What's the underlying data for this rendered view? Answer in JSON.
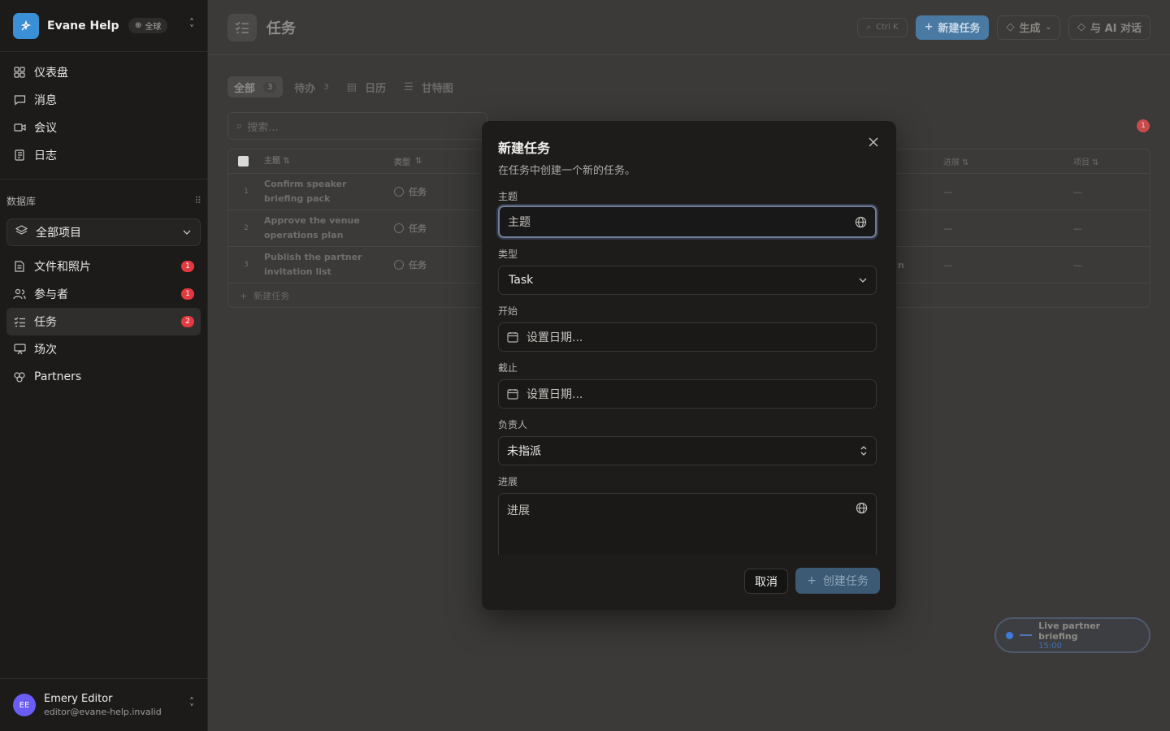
{
  "workspace": {
    "name": "Evane Help ...",
    "badge": "全球"
  },
  "nav": [
    {
      "label": "仪表盘",
      "icon": "dashboard-icon"
    },
    {
      "label": "消息",
      "icon": "message-icon"
    },
    {
      "label": "会议",
      "icon": "video-icon"
    },
    {
      "label": "日志",
      "icon": "journal-icon"
    }
  ],
  "database": {
    "heading": "数据库",
    "project_select": "全部项目"
  },
  "db_items": [
    {
      "label": "文件和照片",
      "badge": "1"
    },
    {
      "label": "参与者",
      "badge": "1"
    },
    {
      "label": "任务",
      "badge": "2"
    },
    {
      "label": "场次",
      "badge": ""
    },
    {
      "label": "Partners",
      "badge": ""
    }
  ],
  "user": {
    "initials": "EE",
    "name": "Emery Editor",
    "email": "editor@evane-help.invalid"
  },
  "page": {
    "title": "任务",
    "kbd": "Ctrl K",
    "new_task": "新建任务",
    "generate": "生成",
    "ai_chat": "与 AI 对话"
  },
  "tabs": [
    {
      "label": "全部",
      "count": "3"
    },
    {
      "label": "待办",
      "count": "3"
    },
    {
      "label": "日历",
      "count": ""
    },
    {
      "label": "甘特图",
      "count": ""
    }
  ],
  "search_placeholder": "搜索...",
  "table": {
    "headers": {
      "subject": "主题",
      "type": "类型",
      "progress": "进展",
      "project": "项目"
    },
    "rows": [
      {
        "num": "1",
        "subject_line1": "Confirm speaker",
        "subject_line2": "briefing pack",
        "type": "任务",
        "progress": "—",
        "project": "—"
      },
      {
        "num": "2",
        "subject_line1": "Approve the venue",
        "subject_line2": "operations plan",
        "type": "任务",
        "progress": "—",
        "project": "—"
      },
      {
        "num": "3",
        "subject_line1": "Publish the partner",
        "subject_line2": "invitation list",
        "type": "任务",
        "progress": "—",
        "project": "—"
      }
    ],
    "add_row": "新建任务",
    "row3_tail": "n"
  },
  "notification_count": "1",
  "live": {
    "title": "Live partner briefing",
    "time": "15:00"
  },
  "modal": {
    "title": "新建任务",
    "subtitle": "在任务中创建一个新的任务。",
    "fields": {
      "subject_label": "主题",
      "subject_placeholder": "主题",
      "type_label": "类型",
      "type_value": "Task",
      "start_label": "开始",
      "start_placeholder": "设置日期...",
      "due_label": "截止",
      "due_placeholder": "设置日期...",
      "assignee_label": "负责人",
      "assignee_value": "未指派",
      "progress_label": "进展",
      "progress_placeholder": "进展"
    },
    "cancel": "取消",
    "create": "创建任务"
  }
}
